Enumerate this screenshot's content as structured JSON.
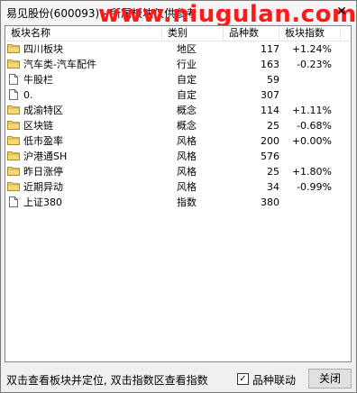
{
  "window": {
    "title": "易见股份(600093) - 所属板块",
    "title_suffix": "仅供参考",
    "watermark": "www.niugulan.com",
    "accent_watermark_color": "#ff1a1a"
  },
  "table": {
    "columns": [
      "板块名称",
      "类别",
      "品种数",
      "板块指数"
    ],
    "rows": [
      {
        "icon": "folder-icon",
        "name": "四川板块",
        "type": "地区",
        "count": "117",
        "index": "+1.24%"
      },
      {
        "icon": "folder-icon",
        "name": "汽车类-汽车配件",
        "type": "行业",
        "count": "163",
        "index": "-0.23%"
      },
      {
        "icon": "document-icon",
        "name": "牛股栏",
        "type": "自定",
        "count": "59",
        "index": ""
      },
      {
        "icon": "document-icon",
        "name": "0.",
        "type": "自定",
        "count": "307",
        "index": ""
      },
      {
        "icon": "folder-icon",
        "name": "成渝特区",
        "type": "概念",
        "count": "114",
        "index": "+1.11%"
      },
      {
        "icon": "folder-icon",
        "name": "区块链",
        "type": "概念",
        "count": "25",
        "index": "-0.68%"
      },
      {
        "icon": "folder-icon",
        "name": "低市盈率",
        "type": "风格",
        "count": "200",
        "index": "+0.00%"
      },
      {
        "icon": "folder-icon",
        "name": "沪港通SH",
        "type": "风格",
        "count": "576",
        "index": ""
      },
      {
        "icon": "folder-icon",
        "name": "昨日涨停",
        "type": "风格",
        "count": "25",
        "index": "+1.80%"
      },
      {
        "icon": "folder-icon",
        "name": "近期异动",
        "type": "风格",
        "count": "34",
        "index": "-0.99%"
      },
      {
        "icon": "document-icon",
        "name": "上证380",
        "type": "指数",
        "count": "380",
        "index": ""
      }
    ]
  },
  "status": {
    "hint": "双击查看板块并定位, 双击指数区查看指数",
    "linkage_label": "品种联动",
    "linkage_checked": true,
    "close_label": "关闭"
  }
}
